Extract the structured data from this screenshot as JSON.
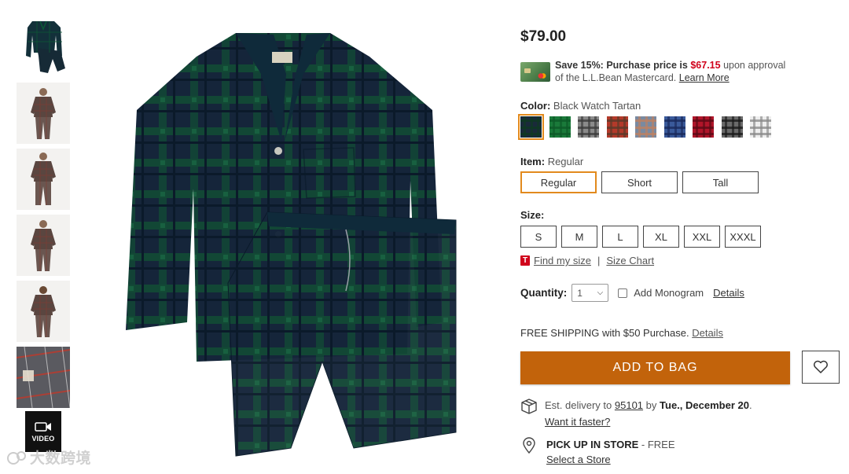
{
  "thumbnails": [
    {
      "name": "thumb-flat-pajamas"
    },
    {
      "name": "thumb-model-front"
    },
    {
      "name": "thumb-model-front-2"
    },
    {
      "name": "thumb-model-side"
    },
    {
      "name": "thumb-model-back"
    },
    {
      "name": "thumb-fabric-closeup"
    }
  ],
  "video": {
    "label": "VIDEO"
  },
  "watermark": {
    "text": "大数跨境"
  },
  "product": {
    "price": "$79.00",
    "promo": {
      "save": "Save 15%: Purchase price is",
      "purchase_price": "$67.15",
      "tail": "upon approval",
      "line2": "of the L.L.Bean Mastercard.",
      "learn_more": "Learn More"
    },
    "color": {
      "label": "Color:",
      "value": "Black Watch Tartan",
      "swatches": [
        {
          "name": "Black Watch Tartan",
          "base": "#1a2a3a",
          "line": "#0f3a22",
          "selected": true
        },
        {
          "name": "Green",
          "base": "#1a7a3a",
          "line": "#0d5a28"
        },
        {
          "name": "Gray Plaid",
          "base": "#8a8a8a",
          "line": "#3a3a3a"
        },
        {
          "name": "Red Plaid",
          "base": "#b33a2a",
          "line": "#5a3a2a"
        },
        {
          "name": "Blue Gray Plaid",
          "base": "#7a8aa0",
          "line": "#c08060"
        },
        {
          "name": "Blue Plaid",
          "base": "#3a5a9a",
          "line": "#1a2a5a"
        },
        {
          "name": "Red",
          "base": "#b0152a",
          "line": "#5a0a15"
        },
        {
          "name": "Charcoal Plaid",
          "base": "#6a6a6a",
          "line": "#1a1a1a"
        },
        {
          "name": "White Plaid",
          "base": "#eeeeee",
          "line": "#888888"
        }
      ]
    },
    "item": {
      "label": "Item:",
      "value": "Regular",
      "options": [
        "Regular",
        "Short",
        "Tall"
      ]
    },
    "size": {
      "label": "Size:",
      "options": [
        "S",
        "M",
        "L",
        "XL",
        "XXL",
        "XXXL"
      ],
      "find_my_size": "Find my size",
      "size_chart": "Size Chart",
      "badge": "T"
    },
    "quantity": {
      "label": "Quantity:",
      "value": "1",
      "monogram_label": "Add Monogram",
      "details": "Details"
    },
    "shipping": {
      "text": "FREE SHIPPING with $50 Purchase.",
      "details": "Details"
    },
    "add_to_bag": "ADD TO BAG",
    "delivery": {
      "prefix": "Est. delivery to",
      "zip": "95101",
      "by": "by",
      "date": "Tue., December 20",
      "faster": "Want it faster?"
    },
    "pickup": {
      "title": "PICK UP IN STORE",
      "suffix": "- FREE",
      "select": "Select a Store"
    }
  },
  "colors": {
    "accent": "#c2630b",
    "selected_outline": "#e28a1d",
    "sale_red": "#d0021b"
  }
}
